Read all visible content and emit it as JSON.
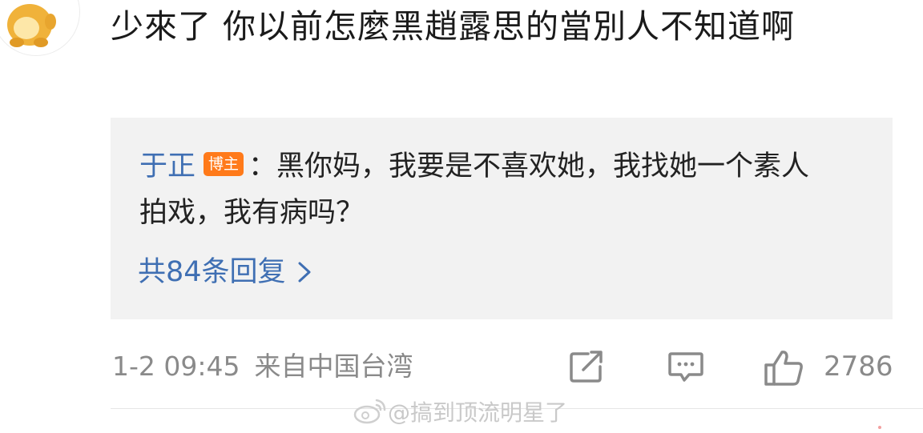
{
  "comment": {
    "text": "少來了 你以前怎麼黑趙露思的當別人不知道啊",
    "avatar_icon": "yellow-character-avatar-icon"
  },
  "reply": {
    "author": "于正",
    "badge": "博主",
    "separator": "：",
    "text": "黑你妈，我要是不喜欢她，我找她一个素人拍戏，我有病吗？",
    "more_label": "共84条回复",
    "more_icon": "chevron-right-icon"
  },
  "footer": {
    "date": "1-2 09:45",
    "source": "来自中国台湾",
    "share_icon": "share-icon",
    "comment_icon": "comment-icon",
    "like_icon": "thumbs-up-icon",
    "like_count": "2786"
  },
  "watermark": {
    "text": "@搞到顶流明星了",
    "icon": "weibo-logo-icon"
  },
  "colors": {
    "link": "#3f6fb3",
    "badge": "#ff7a1a",
    "meta": "#8a8a8a",
    "reply_bg": "#f2f2f2"
  }
}
